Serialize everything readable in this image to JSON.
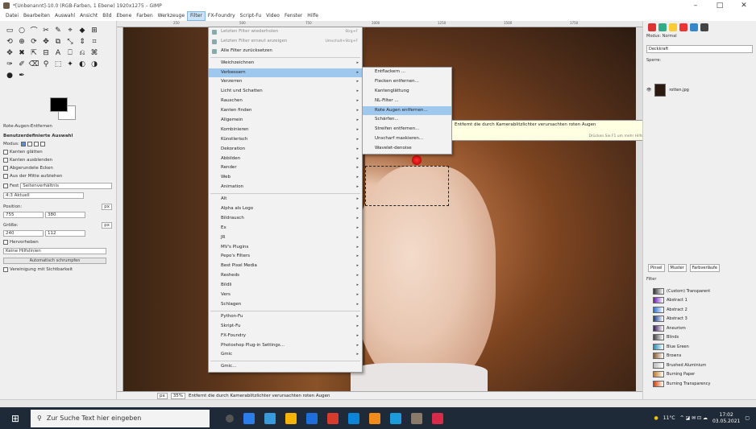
{
  "window": {
    "title": "*[Unbenannt]-10.0 (RGB-Farben, 1 Ebene) 1920x1275 – GIMP",
    "controls": [
      "–",
      "□",
      "✕"
    ]
  },
  "menubar": {
    "items": [
      "Datei",
      "Bearbeiten",
      "Auswahl",
      "Ansicht",
      "Bild",
      "Ebene",
      "Farben",
      "Werkzeuge",
      "Filter",
      "FX-Foundry",
      "Script-Fu",
      "Video",
      "Fenster",
      "Hilfe"
    ],
    "active": "Filter"
  },
  "toolbox": {
    "tools": [
      "▭",
      "○",
      "⌒",
      "✂",
      "✎",
      "⌖",
      "◆",
      "⊞",
      "⟲",
      "⊕",
      "⟳",
      "✥",
      "⧉",
      "⤡",
      "⇕",
      "⌗",
      "✥",
      "✖",
      "⇱",
      "⊟",
      "A",
      "⎕",
      "⎌",
      "⌘",
      "✑",
      "✐",
      "⌫",
      "⚲",
      "⬚",
      "✦",
      "◐",
      "◑",
      "●",
      "✒"
    ],
    "tool_title": "Rote-Augen-Entfernen",
    "section_title": "Benutzerdefinierte Auswahl",
    "mode_label": "Modus:",
    "options": [
      "Kanten glätten",
      "Kanten ausblenden",
      "Abgerundete Ecken",
      "Aus der Mitte aufziehen"
    ],
    "fixed_label": "Fest",
    "fixed_value": "Seitenverhältnis",
    "ratio_value": "4:3 Aktuell",
    "position_label": "Position:",
    "position_unit": "px",
    "position_x": "755",
    "position_y": "380",
    "size_label": "Größe:",
    "size_unit": "px",
    "size_w": "240",
    "size_h": "112",
    "highlight_label": "Hervorheben",
    "guides_value": "Keine Hilfslinien",
    "auto_shrink_button": "Automatisch schrumpfen",
    "merged_label": "Vereinigung mit Sichtbarkeit"
  },
  "ruler": {
    "ticks": [
      "250",
      "500",
      "750",
      "1000",
      "1250",
      "1500",
      "1750"
    ]
  },
  "filter_menu": {
    "items": [
      {
        "label": "Letzten Filter wiederholen",
        "shortcut": "Strg+F",
        "dim": true,
        "icon": true
      },
      {
        "label": "Letzten Filter erneut anzeigen",
        "shortcut": "Umschalt+Strg+F",
        "dim": true,
        "icon": true
      },
      {
        "label": "Alle Filter zurücksetzen",
        "icon": true
      },
      {
        "sep": true
      },
      {
        "label": "Weichzeichnen",
        "arrow": true
      },
      {
        "label": "Verbessern",
        "arrow": true,
        "hl": true
      },
      {
        "label": "Verzerren",
        "arrow": true
      },
      {
        "label": "Licht und Schatten",
        "arrow": true
      },
      {
        "label": "Rauschen",
        "arrow": true
      },
      {
        "label": "Kanten finden",
        "arrow": true
      },
      {
        "label": "Allgemein",
        "arrow": true
      },
      {
        "label": "Kombinieren",
        "arrow": true
      },
      {
        "label": "Künstlerisch",
        "arrow": true
      },
      {
        "label": "Dekoration",
        "arrow": true
      },
      {
        "label": "Abbilden",
        "arrow": true
      },
      {
        "label": "Render",
        "arrow": true
      },
      {
        "label": "Web",
        "arrow": true
      },
      {
        "label": "Animation",
        "arrow": true
      },
      {
        "sep": true
      },
      {
        "label": "Alt",
        "arrow": true
      },
      {
        "label": "Alpha als Logo",
        "arrow": true
      },
      {
        "label": "Bildrausch",
        "arrow": true
      },
      {
        "label": "Ex",
        "arrow": true
      },
      {
        "label": "JR",
        "arrow": true
      },
      {
        "label": "MV's Plugins",
        "arrow": true
      },
      {
        "label": "Pepo's Filters",
        "arrow": true
      },
      {
        "label": "Best Pixel Media",
        "arrow": true
      },
      {
        "label": "Resheds",
        "arrow": true
      },
      {
        "label": "Bildli",
        "arrow": true
      },
      {
        "label": "Vers",
        "arrow": true
      },
      {
        "label": "Schlagen",
        "arrow": true
      },
      {
        "sep": true
      },
      {
        "label": "Python-Fu",
        "arrow": true
      },
      {
        "label": "Skript-Fu",
        "arrow": true
      },
      {
        "label": "FX-Foundry",
        "arrow": true
      },
      {
        "label": "Photoshop Plug-in Settings...",
        "arrow": true
      },
      {
        "label": "Gmic",
        "arrow": true
      },
      {
        "sep": true
      },
      {
        "label": "Gmic..."
      }
    ]
  },
  "enhance_menu": {
    "items": [
      {
        "label": "Entflackern ..."
      },
      {
        "label": "Flecken entfernen..."
      },
      {
        "label": "Kantenglättung"
      },
      {
        "label": "NL-Filter ..."
      },
      {
        "label": "Rote Augen entfernen...",
        "hl": true
      },
      {
        "label": "Schärfen..."
      },
      {
        "label": "Streifen entfernen..."
      },
      {
        "label": "Unscharf maskieren..."
      },
      {
        "label": "Wavelet-denoise"
      }
    ]
  },
  "tooltip": {
    "text": "Entfernt die durch Kamerablitzlichter verursachten roten Augen",
    "hint": "Drücken Sie F1 um mehr Hilfe"
  },
  "canvas_status": {
    "unit": "px",
    "zoom": "35%",
    "message": "Entfernt die durch Kamerablitzlichter verursachten roten Augen"
  },
  "right_dock": {
    "mode_label": "Modus: Normal",
    "opacity_label": "Deckkraft",
    "lock_label": "Sperre:",
    "layer_name": "rotten.jpg",
    "brush_tabs": [
      "Pinsel",
      "Muster",
      "Farbverläufe"
    ],
    "filter_label": "Filter",
    "gradients": [
      {
        "name": "(Custom) Transparent",
        "color": "#333333"
      },
      {
        "name": "Abstract 1",
        "color": "#6a1bb0"
      },
      {
        "name": "Abstract 2",
        "color": "#2b6fd6"
      },
      {
        "name": "Abstract 3",
        "color": "#1a3b8c"
      },
      {
        "name": "Aneurism",
        "color": "#3a1d5a"
      },
      {
        "name": "Blinds",
        "color": "#444444"
      },
      {
        "name": "Blue Green",
        "color": "#1f8fb2"
      },
      {
        "name": "Browns",
        "color": "#8a5a2a"
      },
      {
        "name": "Brushed Aluminium",
        "color": "#bbbbbb"
      },
      {
        "name": "Burning Paper",
        "color": "#c07a20"
      },
      {
        "name": "Burning Transparency",
        "color": "#d04000"
      }
    ]
  },
  "taskbar": {
    "search_placeholder": "Zur Suche Text hier eingeben",
    "weather": "11°C",
    "time": "17:02",
    "date": "03.05.2021"
  },
  "colors": {
    "active_menu": "#9fc8ef",
    "taskbar": "#1f2a38"
  }
}
